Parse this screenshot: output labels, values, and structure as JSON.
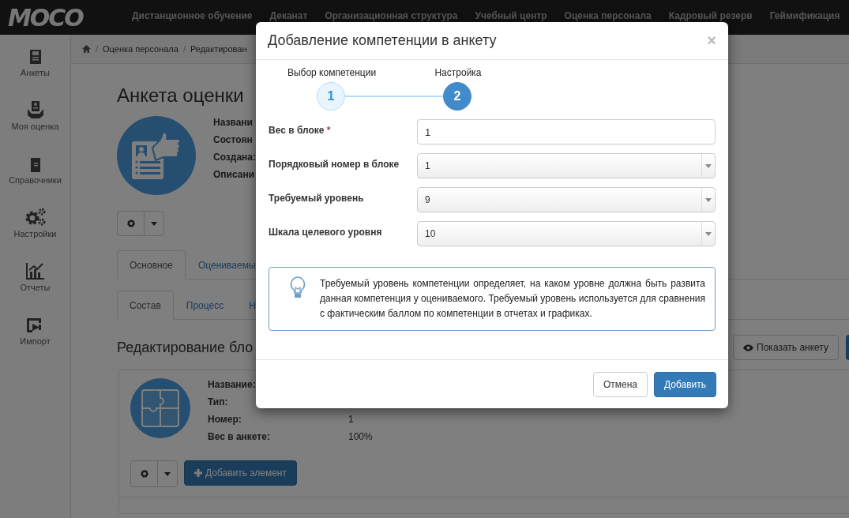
{
  "navbar": {
    "logo": "MOCO",
    "items": [
      "Дистанционное обучение",
      "Деканат",
      "Организационная структура",
      "Учебный центр",
      "Оценка персонала",
      "Кадровый резерв",
      "Геймификация"
    ]
  },
  "sidebar": {
    "items": [
      "Анкеты",
      "Моя оценка",
      "Справочники",
      "Настройки",
      "Отчеты",
      "Импорт"
    ]
  },
  "breadcrumb": [
    {
      "separator": "/",
      "label": "Оценка персонала"
    },
    {
      "separator": "/",
      "label": "Редактирован"
    }
  ],
  "page": {
    "title": "Анкета оценки",
    "info_labels": [
      "Названи",
      "Состоян",
      "Создана:",
      "Описани"
    ],
    "tabs": [
      {
        "label": "Основное",
        "selected": true
      },
      {
        "label": "Оцениваемы",
        "selected": false
      }
    ],
    "subtabs": [
      {
        "label": "Состав",
        "selected": true
      },
      {
        "label": "Процесс",
        "selected": false
      },
      {
        "label": "Н",
        "selected": false
      }
    ],
    "section_title": "Редактирование бло",
    "show_button": "Показать анкету",
    "block_rows": [
      {
        "label": "Название:"
      },
      {
        "label": "Тип:"
      },
      {
        "label": "Номер:",
        "value": "1"
      },
      {
        "label": "Вес в анкете:",
        "value": "100%"
      }
    ],
    "add_button": "Добавить элемент"
  },
  "modal": {
    "title": "Добавление компетенции в анкету",
    "close": "×",
    "steps": [
      {
        "number": "1",
        "label": "Выбор компетенции",
        "selected": false
      },
      {
        "number": "2",
        "label": "Настройка",
        "selected": true
      }
    ],
    "fields": [
      {
        "kind": "input",
        "label": "Вес в блоке",
        "required_mark": "*",
        "value": "1"
      },
      {
        "kind": "select",
        "label": "Порядковый номер в блоке",
        "value": "1"
      },
      {
        "kind": "select",
        "label": "Требуемый уровень",
        "value": "9"
      },
      {
        "kind": "select",
        "label": "Шкала целевого уровня",
        "value": "10"
      }
    ],
    "info": "Требуемый уровень компетенции определяет, на каком уровне должна быть развита данная компетенция у оцениваемого. Требуемый уровень используется для сравнения с фактическим баллом по компетенции в отчетах и графиках.",
    "buttons": [
      {
        "label": "Отмена",
        "kind": "default"
      },
      {
        "label": "Добавить",
        "kind": "primary"
      }
    ]
  }
}
